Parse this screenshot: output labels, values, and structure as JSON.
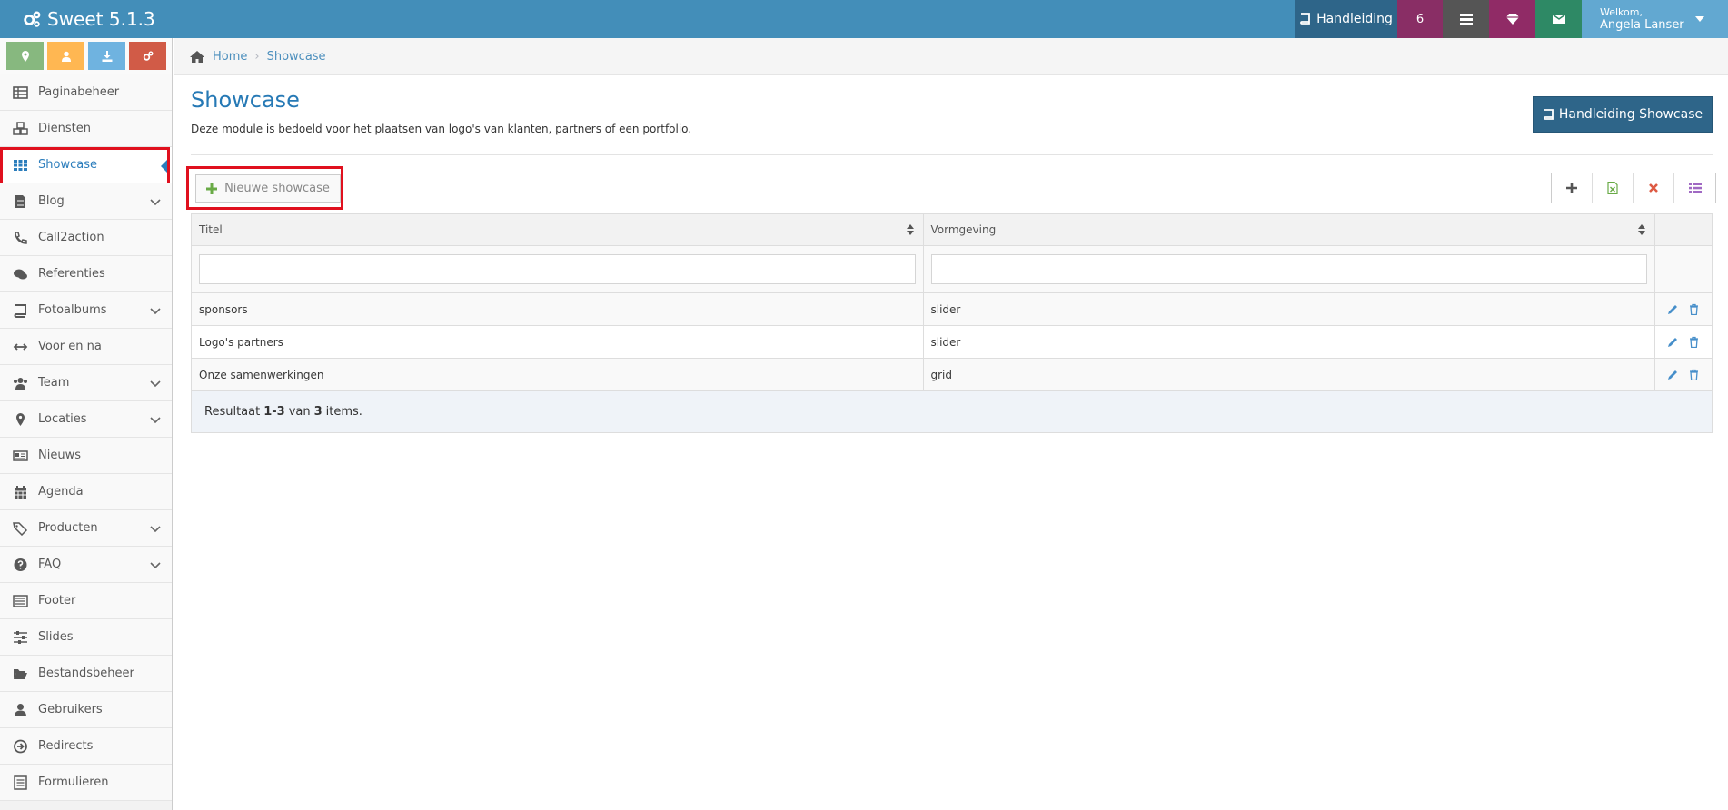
{
  "app": {
    "brand": "Sweet 5.1.3"
  },
  "topnav": {
    "manual_label": "Handleiding",
    "notification_count": "6",
    "welcome_label": "Welkom,",
    "user_name": "Angela Lanser"
  },
  "sidebar": {
    "items": [
      {
        "label": "Paginabeheer",
        "icon": "table-icon",
        "has_children": false
      },
      {
        "label": "Diensten",
        "icon": "cubes-icon",
        "has_children": false
      },
      {
        "label": "Showcase",
        "icon": "grid-icon",
        "has_children": false,
        "active": true
      },
      {
        "label": "Blog",
        "icon": "file-text-icon",
        "has_children": true
      },
      {
        "label": "Call2action",
        "icon": "phone-icon",
        "has_children": false
      },
      {
        "label": "Referenties",
        "icon": "comments-icon",
        "has_children": false
      },
      {
        "label": "Fotoalbums",
        "icon": "book-icon",
        "has_children": true
      },
      {
        "label": "Voor en na",
        "icon": "arrows-h-icon",
        "has_children": false
      },
      {
        "label": "Team",
        "icon": "users-icon",
        "has_children": true
      },
      {
        "label": "Locaties",
        "icon": "map-marker-icon",
        "has_children": true
      },
      {
        "label": "Nieuws",
        "icon": "newspaper-icon",
        "has_children": false
      },
      {
        "label": "Agenda",
        "icon": "calendar-icon",
        "has_children": false
      },
      {
        "label": "Producten",
        "icon": "tags-icon",
        "has_children": true
      },
      {
        "label": "FAQ",
        "icon": "question-icon",
        "has_children": true
      },
      {
        "label": "Footer",
        "icon": "footer-icon",
        "has_children": false
      },
      {
        "label": "Slides",
        "icon": "sliders-icon",
        "has_children": false
      },
      {
        "label": "Bestandsbeheer",
        "icon": "folder-open-icon",
        "has_children": false
      },
      {
        "label": "Gebruikers",
        "icon": "user-icon",
        "has_children": false
      },
      {
        "label": "Redirects",
        "icon": "arrow-circle-icon",
        "has_children": false
      },
      {
        "label": "Formulieren",
        "icon": "list-alt-icon",
        "has_children": false
      }
    ]
  },
  "breadcrumb": {
    "home": "Home",
    "current": "Showcase"
  },
  "page": {
    "title": "Showcase",
    "description": "Deze module is bedoeld voor het plaatsen van logo's van klanten, partners of een portfolio.",
    "manual_button": "Handleiding Showcase",
    "new_button": "Nieuwe showcase"
  },
  "table": {
    "columns": [
      "Titel",
      "Vormgeving"
    ],
    "rows": [
      {
        "titel": "sponsors",
        "vormgeving": "slider"
      },
      {
        "titel": "Logo's partners",
        "vormgeving": "slider"
      },
      {
        "titel": "Onze samenwerkingen",
        "vormgeving": "grid"
      }
    ],
    "summary": {
      "prefix": "Resultaat",
      "range": "1-3",
      "middle": "van",
      "total": "3",
      "suffix": "items."
    }
  },
  "colors": {
    "navbar": "#438eb9",
    "accent": "#2679b5",
    "highlight": "#e0101e"
  }
}
